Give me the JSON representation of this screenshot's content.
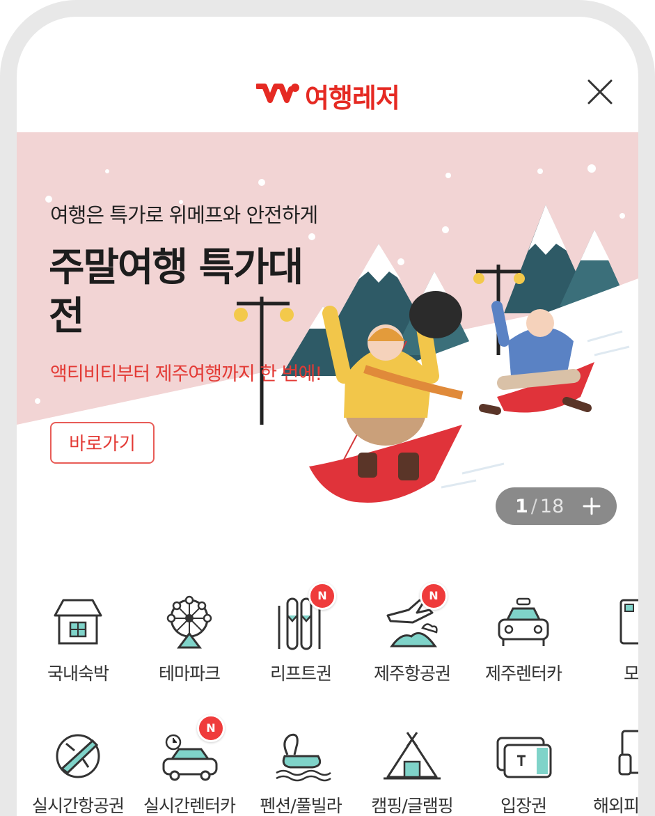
{
  "header": {
    "brand": "여행레저",
    "logo_mark": "W",
    "brand_color": "#e52a23",
    "close_icon": "close-icon"
  },
  "banner": {
    "subtitle": "여행은 특가로 위메프와 안전하게",
    "title": "주말여행 특가대전",
    "description": "액티비티부터 제주여행까지 한 번에!",
    "button_label": "바로가기",
    "pager": {
      "current": "1",
      "separator": "/",
      "total": "18"
    },
    "bg_color": "#f2d4d4"
  },
  "categories": {
    "badge_label": "N",
    "row1": [
      {
        "label": "국내숙박",
        "icon": "house-icon",
        "new": false
      },
      {
        "label": "테마파크",
        "icon": "ferris-wheel-icon",
        "new": false
      },
      {
        "label": "리프트권",
        "icon": "ski-icon",
        "new": true
      },
      {
        "label": "제주항공권",
        "icon": "plane-island-icon",
        "new": true
      },
      {
        "label": "제주렌터카",
        "icon": "taxi-icon",
        "new": false
      },
      {
        "label": "모",
        "icon": "document-icon",
        "new": false
      }
    ],
    "row2": [
      {
        "label": "실시간항공권",
        "icon": "realtime-flight-icon",
        "new": false
      },
      {
        "label": "실시간렌터카",
        "icon": "realtime-car-icon",
        "new": true
      },
      {
        "label": "펜션/풀빌라",
        "icon": "swan-float-icon",
        "new": false
      },
      {
        "label": "캠핑/글램핑",
        "icon": "tent-icon",
        "new": false
      },
      {
        "label": "입장권",
        "icon": "ticket-icon",
        "new": false
      },
      {
        "label": "해외피",
        "icon": "overseas-icon",
        "new": false
      }
    ]
  }
}
